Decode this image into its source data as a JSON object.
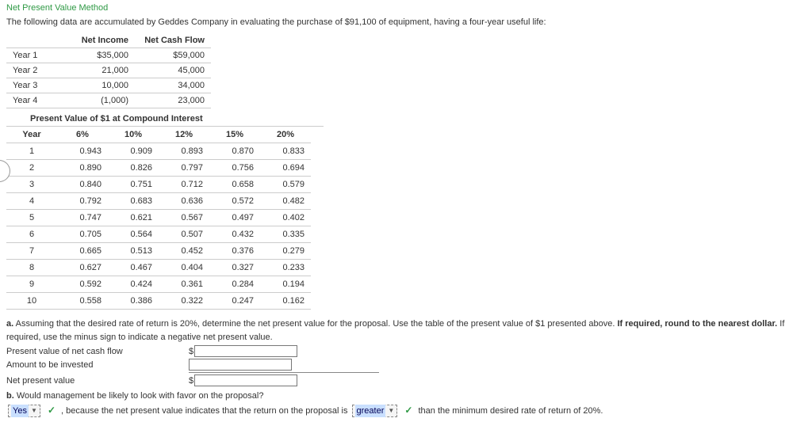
{
  "title": "Net Present Value Method",
  "intro": "The following data are accumulated by Geddes Company in evaluating the purchase of $91,100 of equipment, having a four-year useful life:",
  "cashflow": {
    "headers": {
      "blank": "",
      "ni": "Net Income",
      "ncf": "Net Cash Flow"
    },
    "rows": [
      {
        "year": "Year 1",
        "ni": "$35,000",
        "ncf": "$59,000"
      },
      {
        "year": "Year 2",
        "ni": "21,000",
        "ncf": "45,000"
      },
      {
        "year": "Year 3",
        "ni": "10,000",
        "ncf": "34,000"
      },
      {
        "year": "Year 4",
        "ni": "(1,000)",
        "ncf": "23,000"
      }
    ]
  },
  "pv": {
    "caption": "Present Value of $1 at Compound Interest",
    "headers": [
      "Year",
      "6%",
      "10%",
      "12%",
      "15%",
      "20%"
    ],
    "rows": [
      [
        "1",
        "0.943",
        "0.909",
        "0.893",
        "0.870",
        "0.833"
      ],
      [
        "2",
        "0.890",
        "0.826",
        "0.797",
        "0.756",
        "0.694"
      ],
      [
        "3",
        "0.840",
        "0.751",
        "0.712",
        "0.658",
        "0.579"
      ],
      [
        "4",
        "0.792",
        "0.683",
        "0.636",
        "0.572",
        "0.482"
      ],
      [
        "5",
        "0.747",
        "0.621",
        "0.567",
        "0.497",
        "0.402"
      ],
      [
        "6",
        "0.705",
        "0.564",
        "0.507",
        "0.432",
        "0.335"
      ],
      [
        "7",
        "0.665",
        "0.513",
        "0.452",
        "0.376",
        "0.279"
      ],
      [
        "8",
        "0.627",
        "0.467",
        "0.404",
        "0.327",
        "0.233"
      ],
      [
        "9",
        "0.592",
        "0.424",
        "0.361",
        "0.284",
        "0.194"
      ],
      [
        "10",
        "0.558",
        "0.386",
        "0.322",
        "0.247",
        "0.162"
      ]
    ]
  },
  "qa": {
    "a_prefix": "a.",
    "a_text_1": " Assuming that the desired rate of return is 20%, determine the net present value for the proposal. Use the table of the present value of $1 presented above. ",
    "a_bold": "If required, round to the nearest dollar.",
    "a_text_2": " If required, use the minus sign to indicate a negative net present value.",
    "rows": {
      "r1": "Present value of net cash flow",
      "r2": "Amount to be invested",
      "r3": "Net present value"
    },
    "dollar": "$",
    "b_prefix": "b.",
    "b_text_1": " Would management be likely to look with favor on the proposal?",
    "b_answer_1": "Yes",
    "b_mid": " , because the net present value indicates that the return on the proposal is ",
    "b_answer_2": "greater",
    "b_tail": " than the minimum desired rate of return of 20%."
  }
}
